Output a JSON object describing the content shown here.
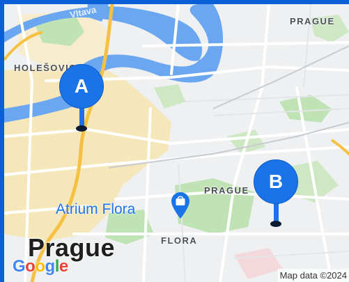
{
  "map": {
    "labels": {
      "river": "Vltava",
      "district_ne": "PRAGUE",
      "district_nw": "HOLEŠOVICE",
      "district_center": "PRAGUE",
      "district_south": "FLORA",
      "city": "Prague",
      "poi": "Atrium Flora"
    },
    "markers": [
      {
        "letter": "A"
      },
      {
        "letter": "B"
      }
    ],
    "attribution": "Map data ©2024",
    "logo": {
      "g1": "G",
      "g2": "o",
      "g3": "o",
      "g4": "g",
      "g5": "l",
      "g6": "e"
    },
    "colors": {
      "frame": "#0b5fd6",
      "marker": "#1a73e8",
      "water": "#6aa7f0",
      "park": "#bfe3b4",
      "urban": "#f5e7b9",
      "road": "#ffffff",
      "highway": "#f6c042"
    },
    "icons": {
      "poi": "shopping-bag-icon",
      "marker": "map-pin-icon"
    }
  }
}
